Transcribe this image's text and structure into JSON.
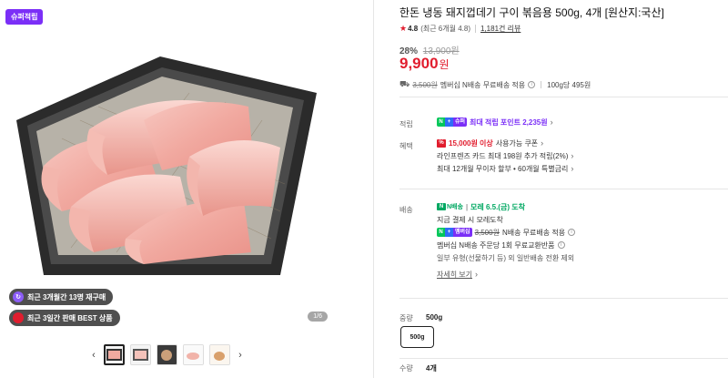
{
  "gallery": {
    "badge": "슈퍼적립",
    "pills": [
      {
        "label": "최근 3개월간 13명 재구매",
        "icon": "repeat-bag-icon"
      },
      {
        "label": "최근 3일간 판매 BEST 상품",
        "icon": "gift-icon"
      }
    ],
    "counter": "1/6",
    "thumb_count": 5,
    "active_thumb": 1
  },
  "product": {
    "title": "한돈 냉동 돼지껍데기 구이 볶음용 500g, 4개 [원산지:국산]",
    "rating_score": "4.8",
    "rating_detail": "(최근 6개월 4.8)",
    "reviews": "1,181건 리뷰",
    "discount_pct": "28%",
    "original_price": "13,900원",
    "price": "9,900",
    "price_unit": "원",
    "shipping_orig": "3,500원",
    "shipping_text": "멤버십 N배송 무료배송 적용",
    "unit_price": "100g당 495원"
  },
  "benefits": {
    "points_label": "적립",
    "points_badge": "슈퍼",
    "points_text": "최대 적립 포인트 2,235원",
    "perks_label": "혜택",
    "coupon_amount": "15,000원 이상",
    "coupon_text": "사용가능 쿠폰",
    "card_text": "라인프렌즈 카드 최대 198원 추가 적립(2%)",
    "installment_text": "최대 12개월 무이자 할부 • 60개월 특별금리"
  },
  "delivery": {
    "label": "배송",
    "badge": "N배송",
    "arrival": "모레 6.5.(금) 도착",
    "note": "지금 결제 시 모레도착",
    "membership_badge": "멤버십",
    "ship_orig": "3,500원",
    "ship_text": "N배송 무료배송 적용",
    "return_text": "멤버십 N배송 주문당 1회 무료교환반품",
    "exception_text": "일부 유형(선물하기 등) 외 일반배송 전환 제외",
    "more_link": "자세히 보기"
  },
  "options": {
    "weight_label": "중량",
    "weight_value": "500g",
    "option_chip": "500g",
    "qty_label": "수량",
    "qty_value": "4개"
  },
  "colors": {
    "accent_red": "#e11d2e",
    "violet": "#7b2ff7",
    "green": "#03c75a"
  }
}
